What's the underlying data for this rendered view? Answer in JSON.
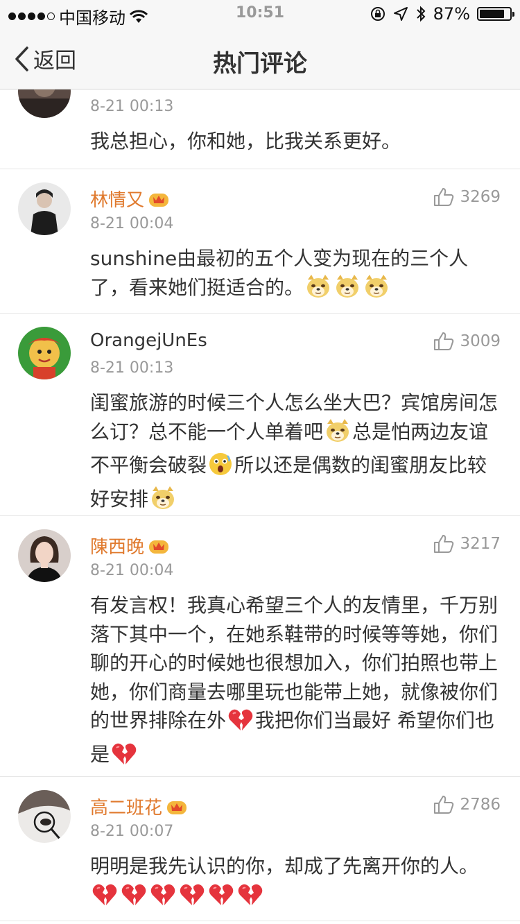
{
  "status_bar": {
    "carrier": "中国移动",
    "time": "10:51",
    "battery": "87%",
    "battery_level": 0.87
  },
  "nav": {
    "back_label": "返回",
    "title": "热门评论"
  },
  "comments": [
    {
      "name": "",
      "time": "8-21 00:13",
      "text": "我总担心，你和她，比我关系更好。"
    },
    {
      "name": "林情又",
      "likes": "3269",
      "time": "8-21 00:04",
      "text_1": "sunshine由最初的五个人变为现在的三个人",
      "text_2": "了，看来她们挺适合的。",
      "emojis": [
        "doge-emoji",
        "doge-emoji",
        "doge-emoji"
      ]
    },
    {
      "name": "OrangejUnEs",
      "likes": "3009",
      "time": "8-21 00:13",
      "text_a": "闺蜜旅游的时候三个人怎么坐大巴？宾馆房间怎么订？总不能一个人单着吧",
      "text_b": "总是怕两边友谊不平衡会破裂",
      "text_c": "所以还是偶数的闺蜜朋友比较好安排"
    },
    {
      "name": "陳西晚",
      "likes": "3217",
      "time": "8-21 00:04",
      "text_a": "有发言权！我真心希望三个人的友情里，千万别落下其中一个，在她系鞋带的时候等等她，你们聊的开心的时候她也很想加入，你们拍照也带上她，你们商量去哪里玩也能带上她，就像被你们的世界排除在外",
      "text_b": "我把你们当最好 希望你们也是"
    },
    {
      "name": "高二班花",
      "likes": "2786",
      "time": "8-21 00:07",
      "text": "明明是我先认识的你，却成了先离开你的人。"
    }
  ]
}
